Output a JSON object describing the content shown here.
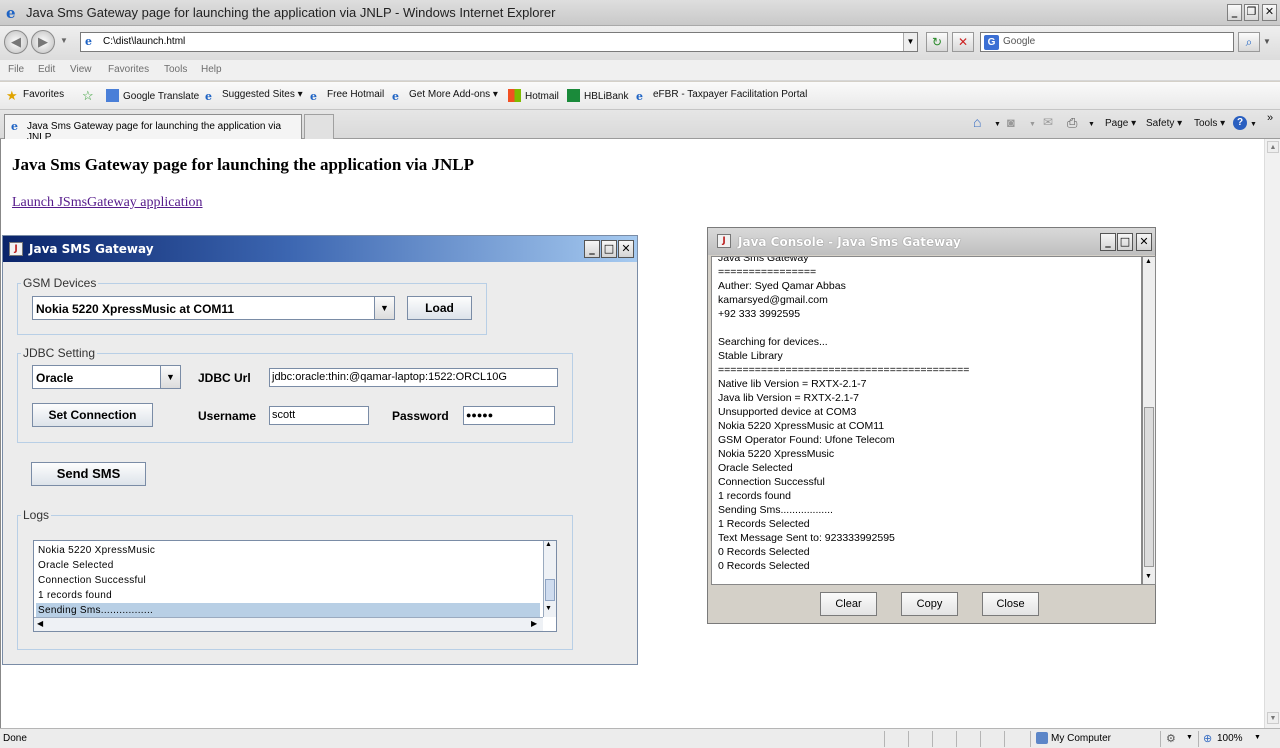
{
  "window": {
    "title": "Java Sms Gateway page for launching the application via JNLP - Windows Internet Explorer"
  },
  "nav": {
    "address": "C:\\dist\\launch.html",
    "search_placeholder": "Google"
  },
  "menu": [
    "File",
    "Edit",
    "View",
    "Favorites",
    "Tools",
    "Help"
  ],
  "favorites": {
    "label": "Favorites",
    "items": [
      "Google Translate",
      "Suggested Sites ▾",
      "Free Hotmail",
      "Get More Add-ons ▾",
      "Hotmail",
      "HBLiBank",
      "eFBR - Taxpayer Facilitation Portal"
    ]
  },
  "tab": {
    "label": "Java Sms Gateway page for launching the application via JNLP"
  },
  "commandbar": [
    "Page ▾",
    "Safety ▾",
    "Tools ▾"
  ],
  "page": {
    "heading": "Java Sms Gateway page for launching the application via JNLP",
    "link": "Launch JSmsGateway application"
  },
  "app": {
    "title": "Java SMS Gateway",
    "gsm_group": "GSM Devices",
    "gsm_device": "Nokia 5220 XpressMusic at COM11",
    "load_button": "Load",
    "jdbc_group": "JDBC Setting",
    "db_type": "Oracle",
    "jdbc_url_label": "JDBC Url",
    "jdbc_url": "jdbc:oracle:thin:@qamar-laptop:1522:ORCL10G",
    "set_connection": "Set Connection",
    "username_label": "Username",
    "username": "scott",
    "password_label": "Password",
    "password": "●●●●●",
    "send_sms": "Send SMS",
    "logs_group": "Logs",
    "logs": [
      "Nokia 5220 XpressMusic",
      "Oracle Selected",
      "Connection Successful",
      "1 records found",
      "Sending Sms................."
    ],
    "selected_log_index": 4
  },
  "console": {
    "title": "Java Console - Java Sms Gateway",
    "lines": [
      "Java Sms Gateway",
      "================",
      "Auther: Syed Qamar Abbas",
      "kamarsyed@gmail.com",
      "+92 333 3992595",
      "",
      "Searching for devices...",
      "Stable Library",
      "=========================================",
      "Native lib Version = RXTX-2.1-7",
      "Java lib Version   = RXTX-2.1-7",
      "Unsupported device  at COM3",
      "Nokia 5220 XpressMusic at COM11",
      "GSM Operator Found: Ufone Telecom",
      "Nokia 5220 XpressMusic",
      "Oracle Selected",
      "Connection Successful",
      "1 records found",
      "Sending Sms..................",
      "1 Records Selected",
      "Text Message Sent to: 923333992595",
      "0 Records Selected",
      "0 Records Selected"
    ],
    "clear": "Clear",
    "copy": "Copy",
    "close": "Close"
  },
  "status": {
    "left": "Done",
    "zone": "My Computer",
    "zoom": "100%"
  }
}
